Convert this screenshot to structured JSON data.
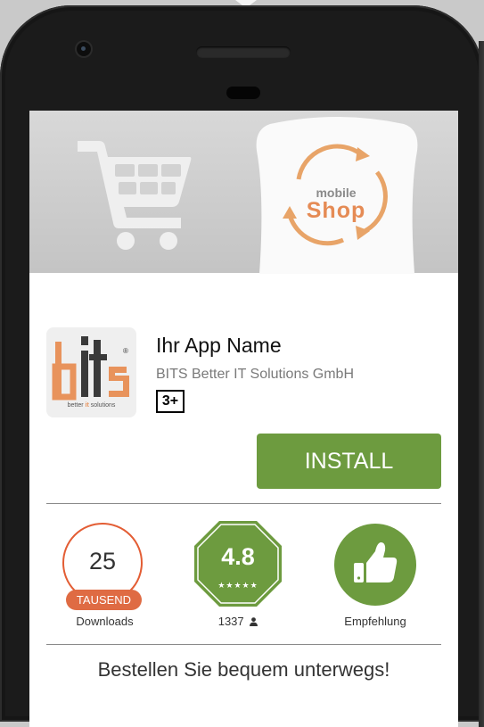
{
  "app": {
    "name": "Ihr App Name",
    "developer": "BITS Better IT Solutions GmbH",
    "age_rating": "3+",
    "install_label": "INSTALL",
    "tagline": "Bestellen Sie bequem unterwegs!"
  },
  "banner": {
    "badge_line1": "mobile",
    "badge_line2": "Shop"
  },
  "logo": {
    "wordmark": "bits",
    "registered": "®",
    "subtitle_prefix": "better ",
    "subtitle_it": "it",
    "subtitle_suffix": " solutions"
  },
  "stats": {
    "downloads": {
      "value": "25",
      "unit": "TAUSEND",
      "label": "Downloads"
    },
    "rating": {
      "value": "4.8",
      "stars": "★★★★★",
      "count": "1337"
    },
    "recommendation": {
      "label": "Empfehlung"
    }
  },
  "colors": {
    "accent_green": "#6d9b3f",
    "accent_orange": "#e35d34",
    "banner_grey": "#cccccc"
  },
  "icons": {
    "cart": "shopping-cart-icon",
    "thumbs_up": "thumbs-up-icon",
    "user": "user-icon",
    "camera": "camera-icon"
  }
}
